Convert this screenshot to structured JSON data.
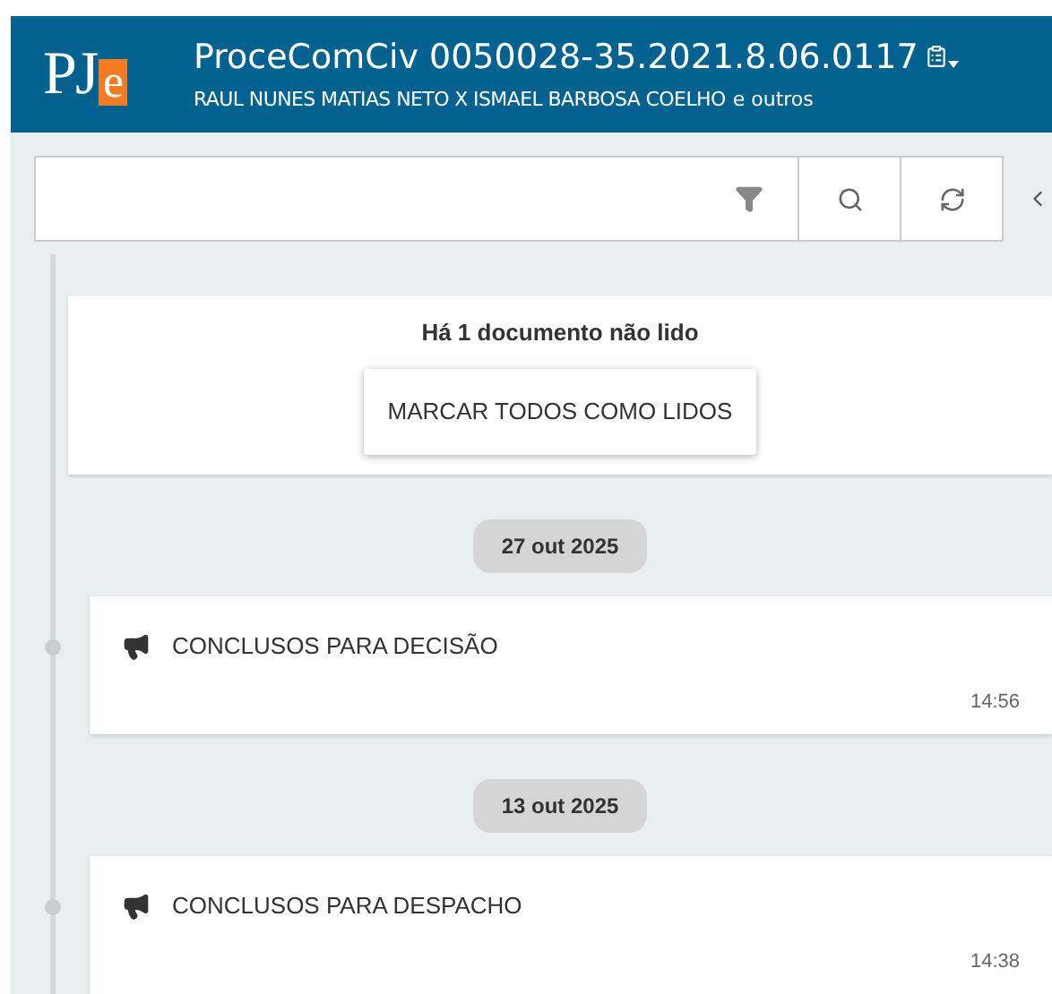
{
  "header": {
    "logo": {
      "main": "PJ",
      "accent": "e"
    },
    "title": "ProceComCiv 0050028-35.2021.8.06.0117",
    "subtitle": "RAUL NUNES MATIAS NETO X ISMAEL BARBOSA COELHO",
    "subtitle_suffix": "e outros"
  },
  "unread": {
    "message": "Há 1 documento não lido",
    "button": "MARCAR TODOS COMO LIDOS"
  },
  "timeline": [
    {
      "date": "27 out 2025",
      "events": [
        {
          "title": "CONCLUSOS PARA DECISÃO",
          "time": "14:56"
        }
      ]
    },
    {
      "date": "13 out 2025",
      "events": [
        {
          "title": "CONCLUSOS PARA DESPACHO",
          "time": "14:38"
        }
      ]
    }
  ]
}
